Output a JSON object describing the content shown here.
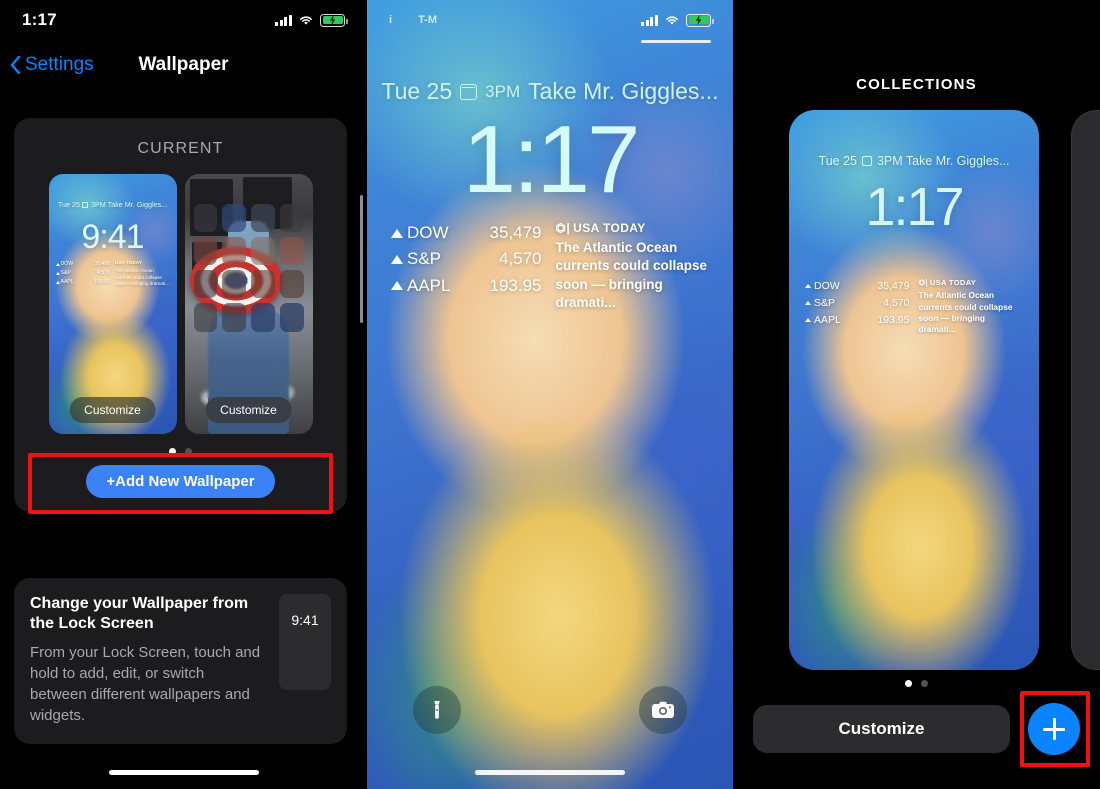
{
  "panel1": {
    "status": {
      "time": "1:17",
      "signal_icon": "cellular-bars-icon",
      "wifi_icon": "wifi-icon",
      "battery_icon": "battery-charging-icon"
    },
    "nav": {
      "back_label": "Settings",
      "title": "Wallpaper",
      "back_icon": "chevron-left-icon"
    },
    "current_card": {
      "header": "CURRENT"
    },
    "preview_lock": {
      "date": "Tue 25",
      "calendar_icon": "calendar-icon",
      "event": "3PM Take Mr. Giggles...",
      "time": "9:41",
      "customize_label": "Customize",
      "stocks": [
        {
          "symbol": "DOW",
          "value": "35,488"
        },
        {
          "symbol": "S&P",
          "value": "4,571"
        },
        {
          "symbol": "AAPL",
          "value": "193.83"
        }
      ],
      "news": {
        "brand": "USA TODAY",
        "headline": "The Atlantic Ocean currents could collapse soon — bringing dramati..."
      }
    },
    "preview_home": {
      "customize_label": "Customize"
    },
    "page_dots": {
      "count": 2,
      "active": 0
    },
    "add_button": {
      "label": "+Add New Wallpaper",
      "highlight_color": "#f01212",
      "fill_color": "#3b82f6"
    },
    "info_card": {
      "heading": "Change your Wallpaper from the Lock Screen",
      "body": "From your Lock Screen, touch and hold to add, edit, or switch between different wallpapers and widgets.",
      "mini_time": "9:41"
    }
  },
  "panel2": {
    "status": {
      "left_glyph": "i",
      "carrier": "T-M",
      "signal_icon": "cellular-bars-icon",
      "wifi_icon": "wifi-icon",
      "battery_icon": "battery-charging-icon"
    },
    "date": "Tue 25",
    "calendar_icon": "calendar-icon",
    "event_time": "3PM",
    "event_title": "Take Mr. Giggles...",
    "time": "1:17",
    "stocks": [
      {
        "symbol": "DOW",
        "value": "35,479"
      },
      {
        "symbol": "S&P",
        "value": "4,570"
      },
      {
        "symbol": "AAPL",
        "value": "193.95"
      }
    ],
    "news": {
      "brand": "USA TODAY",
      "headline": "The Atlantic Ocean currents could collapse soon — bringing dramati..."
    },
    "flashlight_icon": "flashlight-icon",
    "camera_icon": "camera-icon"
  },
  "panel3": {
    "header": "COLLECTIONS",
    "card": {
      "date": "Tue 25",
      "calendar_icon": "calendar-icon",
      "event": "3PM Take Mr. Giggles...",
      "time": "1:17",
      "stocks": [
        {
          "symbol": "DOW",
          "value": "35,479"
        },
        {
          "symbol": "S&P",
          "value": "4,570"
        },
        {
          "symbol": "AAPL",
          "value": "193.95"
        }
      ],
      "news": {
        "brand": "USA TODAY",
        "headline": "The Atlantic Ocean currents could collapse soon — bringing dramati..."
      }
    },
    "page_dots": {
      "count": 2,
      "active": 0
    },
    "customize_label": "Customize",
    "add_fab": {
      "icon": "plus-icon",
      "highlight_color": "#f01212",
      "fill_color": "#0a84ff"
    }
  }
}
